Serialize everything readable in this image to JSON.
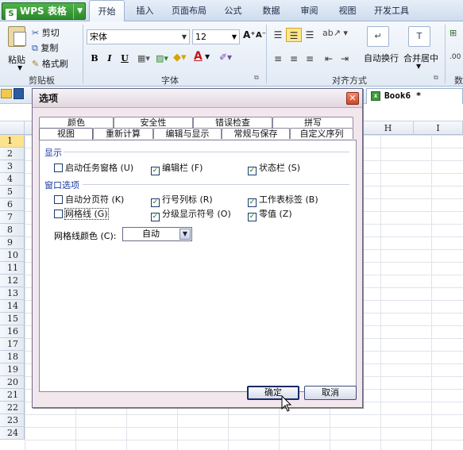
{
  "app": {
    "name": "WPS 表格",
    "logo": "S"
  },
  "ribbon": {
    "tabs": [
      "开始",
      "插入",
      "页面布局",
      "公式",
      "数据",
      "审阅",
      "视图",
      "开发工具"
    ],
    "active_tab": "开始",
    "clipboard": {
      "paste_label": "粘贴",
      "cut_label": "剪切",
      "copy_label": "复制",
      "format_painter_label": "格式刷",
      "group_label": "剪贴板"
    },
    "font": {
      "font_name": "宋体",
      "font_size": "12",
      "group_label": "字体",
      "bold": "B",
      "italic": "I",
      "underline": "U",
      "grow": "A⁺",
      "shrink": "A⁻"
    },
    "alignment": {
      "wrap_label": "自动换行",
      "merge_label": "合并居中",
      "group_label": "对齐方式"
    },
    "number_group_label_partial": "数"
  },
  "workbook": {
    "tab_name": "Book6 *"
  },
  "grid": {
    "columns": [
      "H",
      "I"
    ],
    "rows": [
      "1",
      "2",
      "3",
      "4",
      "5",
      "6",
      "7",
      "8",
      "9",
      "10",
      "11",
      "12",
      "13",
      "14",
      "15",
      "16",
      "17",
      "18",
      "19",
      "20",
      "21",
      "22",
      "23",
      "24"
    ]
  },
  "dialog": {
    "title": "选项",
    "tabs_back": [
      "颜色",
      "安全性",
      "错误检查",
      "拼写"
    ],
    "tabs_front": [
      "视图",
      "重新计算",
      "编辑与显示",
      "常规与保存",
      "自定义序列"
    ],
    "active_tab": "视图",
    "show_section": {
      "label": "显示",
      "options": [
        {
          "label": "启动任务窗格 (U)",
          "checked": false
        },
        {
          "label": "编辑栏 (F)",
          "checked": true
        },
        {
          "label": "状态栏 (S)",
          "checked": true
        }
      ]
    },
    "window_section": {
      "label": "窗口选项",
      "options": [
        {
          "label": "自动分页符 (K)",
          "checked": false
        },
        {
          "label": "行号列标 (R)",
          "checked": true
        },
        {
          "label": "工作表标签 (B)",
          "checked": true
        },
        {
          "label": "网格线 (G)",
          "checked": false
        },
        {
          "label": "分级显示符号 (O)",
          "checked": true
        },
        {
          "label": "零值 (Z)",
          "checked": true
        }
      ]
    },
    "gridline_color": {
      "label": "网格线颜色 (C):",
      "value": "自动"
    },
    "ok_label": "确定",
    "cancel_label": "取消"
  },
  "icons": {
    "close": "✕",
    "check": "✓",
    "dropdown": "▼"
  }
}
